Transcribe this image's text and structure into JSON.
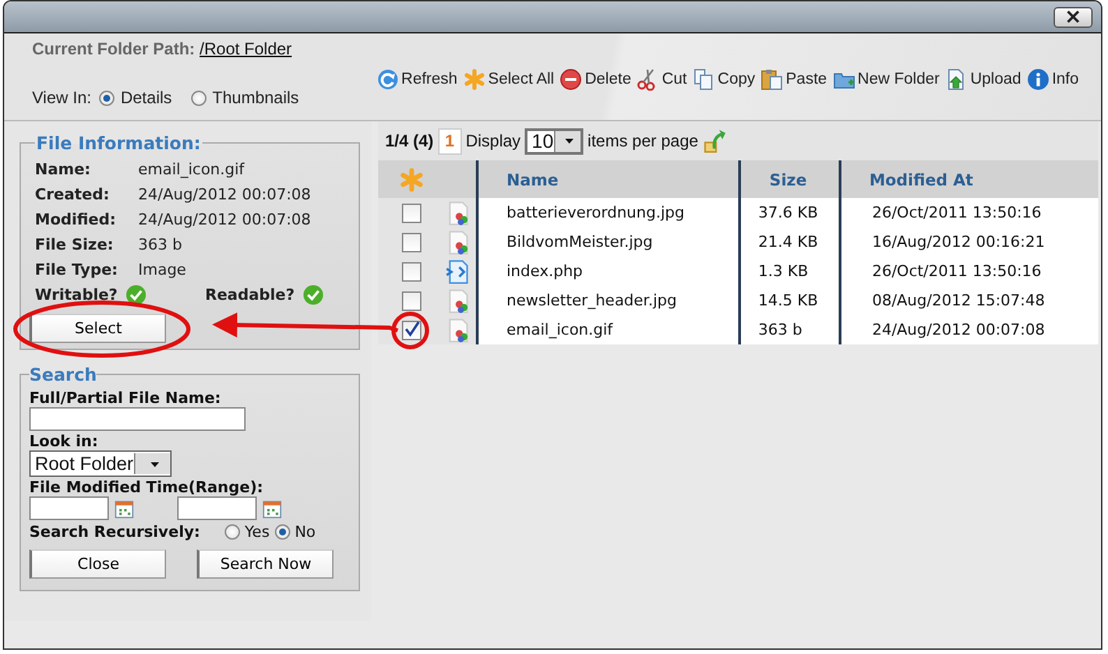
{
  "path": {
    "label": "Current Folder Path:",
    "prefix": "/",
    "link": "Root Folder"
  },
  "view": {
    "label": "View In:",
    "options": [
      {
        "label": "Details",
        "selected": true
      },
      {
        "label": "Thumbnails",
        "selected": false
      }
    ]
  },
  "toolbar": [
    {
      "kind": "refresh",
      "label": "Refresh"
    },
    {
      "kind": "select_all",
      "label": "Select All"
    },
    {
      "kind": "delete",
      "label": "Delete"
    },
    {
      "kind": "cut",
      "label": "Cut"
    },
    {
      "kind": "copy",
      "label": "Copy"
    },
    {
      "kind": "paste",
      "label": "Paste"
    },
    {
      "kind": "new_folder",
      "label": "New Folder"
    },
    {
      "kind": "upload",
      "label": "Upload"
    },
    {
      "kind": "info",
      "label": "Info"
    }
  ],
  "file_info": {
    "title": "File Information:",
    "fields": [
      {
        "label": "Name:",
        "value": "email_icon.gif"
      },
      {
        "label": "Created:",
        "value": "24/Aug/2012 00:07:08"
      },
      {
        "label": "Modified:",
        "value": "24/Aug/2012 00:07:08"
      },
      {
        "label": "File Size:",
        "value": "363 b"
      },
      {
        "label": "File Type:",
        "value": "Image"
      }
    ],
    "flags": [
      {
        "label": "Writable?",
        "on": true
      },
      {
        "label": "Readable?",
        "on": true
      }
    ],
    "button": "Select"
  },
  "search": {
    "title": "Search",
    "name_label": "Full/Partial File Name:",
    "look_in_label": "Look in:",
    "look_in": "Root Folder",
    "time_label": "File Modified Time(Range):",
    "recursive_label": "Search Recursively:",
    "recursive_options": [
      {
        "label": "Yes",
        "selected": false
      },
      {
        "label": "No",
        "selected": true
      }
    ],
    "buttons": [
      "Close",
      "Search Now"
    ]
  },
  "pager": {
    "status": "1/4 (4)",
    "page": "1",
    "display": "Display",
    "per_page": "10",
    "suffix": "items per page"
  },
  "table": {
    "columns": [
      "Name",
      "Size",
      "Modified At"
    ],
    "rows": [
      {
        "kind": "image",
        "name": "batterieverordnung.jpg",
        "size": "37.6 KB",
        "modified": "26/Oct/2011 13:50:16",
        "checked": false
      },
      {
        "kind": "image",
        "name": "BildvomMeister.jpg",
        "size": "21.4 KB",
        "modified": "16/Aug/2012 00:16:21",
        "checked": false
      },
      {
        "kind": "php",
        "name": "index.php",
        "size": "1.3 KB",
        "modified": "26/Oct/2011 13:50:16",
        "checked": false
      },
      {
        "kind": "image",
        "name": "newsletter_header.jpg",
        "size": "14.5 KB",
        "modified": "08/Aug/2012 15:07:48",
        "checked": false
      },
      {
        "kind": "image",
        "name": "email_icon.gif",
        "size": "363 b",
        "modified": "24/Aug/2012 00:07:08",
        "checked": true
      }
    ]
  }
}
